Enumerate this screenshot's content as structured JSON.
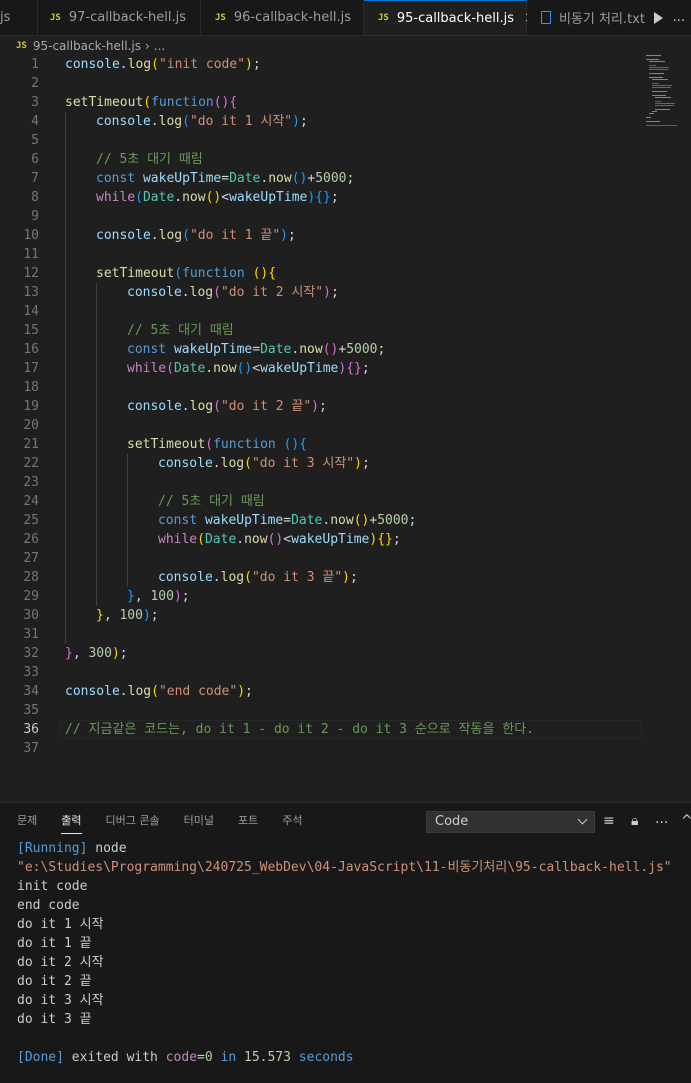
{
  "tabs": [
    {
      "label": "js",
      "active": false,
      "icon": "js-icon"
    },
    {
      "label": "97-callback-hell.js",
      "active": false,
      "icon": "js-icon"
    },
    {
      "label": "96-callback-hell.js",
      "active": false,
      "icon": "js-icon"
    },
    {
      "label": "95-callback-hell.js",
      "active": true,
      "icon": "js-icon"
    },
    {
      "label": "비동기 처리.txt",
      "active": false,
      "icon": "text-file-icon"
    }
  ],
  "icons": {
    "js": "JS",
    "close": "×",
    "ellipsis": "...",
    "chevron": "›"
  },
  "breadcrumb": {
    "file": "95-callback-hell.js",
    "rest": "..."
  },
  "editor": {
    "current_line": 36,
    "lines": [
      {
        "n": 1,
        "i": 0,
        "t": [
          [
            "console",
            "var"
          ],
          [
            ".",
            null
          ],
          [
            "log",
            "fn"
          ],
          [
            "(",
            "b1"
          ],
          [
            "\"init code\"",
            "str"
          ],
          [
            ")",
            "b1"
          ],
          [
            ";",
            null
          ]
        ]
      },
      {
        "n": 2,
        "i": 0,
        "t": []
      },
      {
        "n": 3,
        "i": 0,
        "t": [
          [
            "setTimeout",
            "fn"
          ],
          [
            "(",
            "b1"
          ],
          [
            "function",
            "kw"
          ],
          [
            "()",
            "b2"
          ],
          [
            "{",
            "b2"
          ]
        ]
      },
      {
        "n": 4,
        "i": 1,
        "t": [
          [
            "console",
            "var"
          ],
          [
            ".",
            null
          ],
          [
            "log",
            "fn"
          ],
          [
            "(",
            "b3"
          ],
          [
            "\"do it 1 시작\"",
            "str"
          ],
          [
            ")",
            "b3"
          ],
          [
            ";",
            null
          ]
        ]
      },
      {
        "n": 5,
        "i": 0,
        "t": []
      },
      {
        "n": 6,
        "i": 1,
        "t": [
          [
            "// 5초 대기 때림",
            "cmt"
          ]
        ]
      },
      {
        "n": 7,
        "i": 1,
        "t": [
          [
            "const",
            "kw"
          ],
          [
            " ",
            null
          ],
          [
            "wakeUpTime",
            "var"
          ],
          [
            "=",
            null
          ],
          [
            "Date",
            "cls"
          ],
          [
            ".",
            null
          ],
          [
            "now",
            "fn"
          ],
          [
            "()",
            "b3"
          ],
          [
            "+",
            null
          ],
          [
            "5000",
            "num"
          ],
          [
            ";",
            null
          ]
        ]
      },
      {
        "n": 8,
        "i": 1,
        "t": [
          [
            "while",
            "ctl"
          ],
          [
            "(",
            "b3"
          ],
          [
            "Date",
            "cls"
          ],
          [
            ".",
            null
          ],
          [
            "now",
            "fn"
          ],
          [
            "()",
            "b1"
          ],
          [
            "<",
            null
          ],
          [
            "wakeUpTime",
            "var"
          ],
          [
            ")",
            "b3"
          ],
          [
            "{}",
            "b3"
          ],
          [
            ";",
            null
          ]
        ]
      },
      {
        "n": 9,
        "i": 0,
        "t": []
      },
      {
        "n": 10,
        "i": 1,
        "t": [
          [
            "console",
            "var"
          ],
          [
            ".",
            null
          ],
          [
            "log",
            "fn"
          ],
          [
            "(",
            "b3"
          ],
          [
            "\"do it 1 끝\"",
            "str"
          ],
          [
            ")",
            "b3"
          ],
          [
            ";",
            null
          ]
        ]
      },
      {
        "n": 11,
        "i": 0,
        "t": []
      },
      {
        "n": 12,
        "i": 1,
        "t": [
          [
            "setTimeout",
            "fn"
          ],
          [
            "(",
            "b3"
          ],
          [
            "function",
            "kw"
          ],
          [
            " ",
            null
          ],
          [
            "()",
            "b1"
          ],
          [
            "{",
            "b1"
          ]
        ]
      },
      {
        "n": 13,
        "i": 2,
        "t": [
          [
            "console",
            "var"
          ],
          [
            ".",
            null
          ],
          [
            "log",
            "fn"
          ],
          [
            "(",
            "b2"
          ],
          [
            "\"do it 2 시작\"",
            "str"
          ],
          [
            ")",
            "b2"
          ],
          [
            ";",
            null
          ]
        ]
      },
      {
        "n": 14,
        "i": 0,
        "t": []
      },
      {
        "n": 15,
        "i": 2,
        "t": [
          [
            "// 5초 대기 때림",
            "cmt"
          ]
        ]
      },
      {
        "n": 16,
        "i": 2,
        "t": [
          [
            "const",
            "kw"
          ],
          [
            " ",
            null
          ],
          [
            "wakeUpTime",
            "var"
          ],
          [
            "=",
            null
          ],
          [
            "Date",
            "cls"
          ],
          [
            ".",
            null
          ],
          [
            "now",
            "fn"
          ],
          [
            "()",
            "b2"
          ],
          [
            "+",
            null
          ],
          [
            "5000",
            "num"
          ],
          [
            ";",
            null
          ]
        ]
      },
      {
        "n": 17,
        "i": 2,
        "t": [
          [
            "while",
            "ctl"
          ],
          [
            "(",
            "b2"
          ],
          [
            "Date",
            "cls"
          ],
          [
            ".",
            null
          ],
          [
            "now",
            "fn"
          ],
          [
            "()",
            "b3"
          ],
          [
            "<",
            null
          ],
          [
            "wakeUpTime",
            "var"
          ],
          [
            ")",
            "b2"
          ],
          [
            "{}",
            "b2"
          ],
          [
            ";",
            null
          ]
        ]
      },
      {
        "n": 18,
        "i": 0,
        "t": []
      },
      {
        "n": 19,
        "i": 2,
        "t": [
          [
            "console",
            "var"
          ],
          [
            ".",
            null
          ],
          [
            "log",
            "fn"
          ],
          [
            "(",
            "b2"
          ],
          [
            "\"do it 2 끝\"",
            "str"
          ],
          [
            ")",
            "b2"
          ],
          [
            ";",
            null
          ]
        ]
      },
      {
        "n": 20,
        "i": 0,
        "t": []
      },
      {
        "n": 21,
        "i": 2,
        "t": [
          [
            "setTimeout",
            "fn"
          ],
          [
            "(",
            "b2"
          ],
          [
            "function",
            "kw"
          ],
          [
            " ",
            null
          ],
          [
            "()",
            "b3"
          ],
          [
            "{",
            "b3"
          ]
        ]
      },
      {
        "n": 22,
        "i": 3,
        "t": [
          [
            "console",
            "var"
          ],
          [
            ".",
            null
          ],
          [
            "log",
            "fn"
          ],
          [
            "(",
            "b1"
          ],
          [
            "\"do it 3 시작\"",
            "str"
          ],
          [
            ")",
            "b1"
          ],
          [
            ";",
            null
          ]
        ]
      },
      {
        "n": 23,
        "i": 0,
        "t": []
      },
      {
        "n": 24,
        "i": 3,
        "t": [
          [
            "// 5초 대기 때림",
            "cmt"
          ]
        ]
      },
      {
        "n": 25,
        "i": 3,
        "t": [
          [
            "const",
            "kw"
          ],
          [
            " ",
            null
          ],
          [
            "wakeUpTime",
            "var"
          ],
          [
            "=",
            null
          ],
          [
            "Date",
            "cls"
          ],
          [
            ".",
            null
          ],
          [
            "now",
            "fn"
          ],
          [
            "()",
            "b1"
          ],
          [
            "+",
            null
          ],
          [
            "5000",
            "num"
          ],
          [
            ";",
            null
          ]
        ]
      },
      {
        "n": 26,
        "i": 3,
        "t": [
          [
            "while",
            "ctl"
          ],
          [
            "(",
            "b1"
          ],
          [
            "Date",
            "cls"
          ],
          [
            ".",
            null
          ],
          [
            "now",
            "fn"
          ],
          [
            "()",
            "b2"
          ],
          [
            "<",
            null
          ],
          [
            "wakeUpTime",
            "var"
          ],
          [
            ")",
            "b1"
          ],
          [
            "{}",
            "b1"
          ],
          [
            ";",
            null
          ]
        ]
      },
      {
        "n": 27,
        "i": 0,
        "t": []
      },
      {
        "n": 28,
        "i": 3,
        "t": [
          [
            "console",
            "var"
          ],
          [
            ".",
            null
          ],
          [
            "log",
            "fn"
          ],
          [
            "(",
            "b1"
          ],
          [
            "\"do it 3 끝\"",
            "str"
          ],
          [
            ")",
            "b1"
          ],
          [
            ";",
            null
          ]
        ]
      },
      {
        "n": 29,
        "i": 2,
        "t": [
          [
            "}",
            "b3"
          ],
          [
            ", ",
            null
          ],
          [
            "100",
            "num"
          ],
          [
            ")",
            "b2"
          ],
          [
            ";",
            null
          ]
        ]
      },
      {
        "n": 30,
        "i": 1,
        "t": [
          [
            "}",
            "b1"
          ],
          [
            ", ",
            null
          ],
          [
            "100",
            "num"
          ],
          [
            ")",
            "b3"
          ],
          [
            ";",
            null
          ]
        ]
      },
      {
        "n": 31,
        "i": 0,
        "t": []
      },
      {
        "n": 32,
        "i": 0,
        "t": [
          [
            "}",
            "b2"
          ],
          [
            ", ",
            null
          ],
          [
            "300",
            "num"
          ],
          [
            ")",
            "b1"
          ],
          [
            ";",
            null
          ]
        ]
      },
      {
        "n": 33,
        "i": 0,
        "t": []
      },
      {
        "n": 34,
        "i": 0,
        "t": [
          [
            "console",
            "var"
          ],
          [
            ".",
            null
          ],
          [
            "log",
            "fn"
          ],
          [
            "(",
            "b1"
          ],
          [
            "\"end code\"",
            "str"
          ],
          [
            ")",
            "b1"
          ],
          [
            ";",
            null
          ]
        ]
      },
      {
        "n": 35,
        "i": 0,
        "t": []
      },
      {
        "n": 36,
        "i": 0,
        "t": [
          [
            "// 지금같은 코드는, do it 1 - do it 2 - do it 3 순으로 작동을 한다.",
            "cmt"
          ]
        ]
      },
      {
        "n": 37,
        "i": 0,
        "t": []
      }
    ]
  },
  "panel": {
    "tabs": [
      "문제",
      "출력",
      "디버그 콘솔",
      "터미널",
      "포트",
      "주석"
    ],
    "active_tab": "출력",
    "channel": "Code",
    "output": {
      "running_tag": "[Running]",
      "running_cmd": " node",
      "path": "\"e:\\Studies\\Programming\\240725_WebDev\\04-JavaScript\\11-비동기처리\\95-callback-hell.js\"",
      "lines": [
        "init code",
        "end code",
        "do it 1 시작",
        "do it 1 끝",
        "do it 2 시작",
        "do it 2 끝",
        "do it 3 시작",
        "do it 3 끝"
      ],
      "done_tag": "[Done]",
      "done_text": " exited with ",
      "code_key": "code",
      "code_eq": "=",
      "code_val": "0",
      "in_text": " in ",
      "seconds": "15.573",
      "seconds_label": " seconds"
    }
  }
}
